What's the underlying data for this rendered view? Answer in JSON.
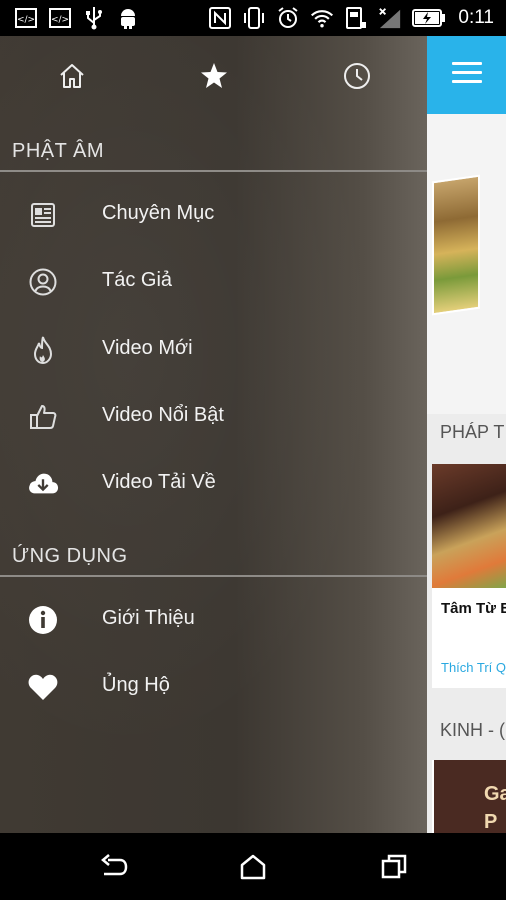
{
  "status_bar": {
    "time": "0:11",
    "left_icons": [
      "code-icon",
      "code-icon",
      "usb-icon",
      "android-icon"
    ],
    "right_icons": [
      "nfc-icon",
      "vibrate-icon",
      "alarm-icon",
      "wifi-icon",
      "battery-saver-icon",
      "no-signal-icon",
      "battery-charging-icon"
    ]
  },
  "drawer": {
    "tabs": [
      {
        "name": "home",
        "icon": "home-icon"
      },
      {
        "name": "favorites",
        "icon": "star-icon"
      },
      {
        "name": "history",
        "icon": "clock-icon"
      }
    ],
    "sections": [
      {
        "title": "PHẬT ÂM",
        "items": [
          {
            "label": "Chuyên Mục",
            "icon": "newspaper-icon"
          },
          {
            "label": "Tác Giả",
            "icon": "user-circle-icon"
          },
          {
            "label": "Video Mới",
            "icon": "flame-icon"
          },
          {
            "label": "Video Nổi Bật",
            "icon": "thumbs-up-icon"
          },
          {
            "label": "Video Tải Về",
            "icon": "cloud-download-icon"
          }
        ]
      },
      {
        "title": "ỨNG DỤNG",
        "items": [
          {
            "label": "Giới Thiệu",
            "icon": "info-icon"
          },
          {
            "label": "Ủng Hộ",
            "icon": "heart-icon"
          }
        ]
      }
    ]
  },
  "background_app": {
    "toolbar_color": "#29b3ea",
    "section1_title": "PHÁP T",
    "card_title": "Tâm Từ B",
    "card_subtitle": "Thích Trí Q",
    "section2_title": "KINH - (",
    "card2_text": "Ga\nP"
  },
  "navbar": {
    "buttons": [
      "back-icon",
      "home-nav-icon",
      "recents-icon"
    ]
  }
}
